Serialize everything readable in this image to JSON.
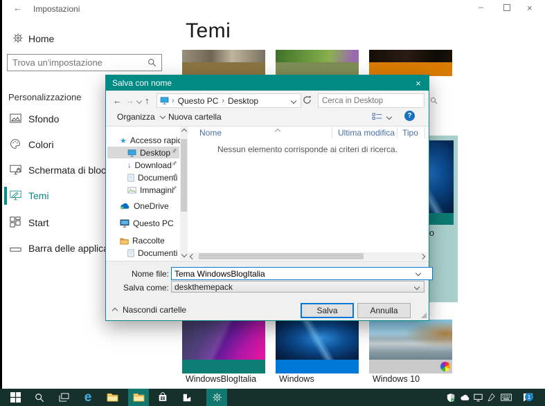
{
  "colors": {
    "accent_teal": "#008a84",
    "dialog_border": "#0b8984",
    "selection_light_teal": "#a9cfcc",
    "taskbar_bg": "#16302b",
    "taskbar_active_bg": "#11776e",
    "windows_blue": "#0078d7",
    "column_header_text": "#4a6fa5",
    "theme_bar_wbi": "#0d7e74",
    "theme_bar_windows": "#0078d7",
    "theme_bar_windows10": "#c9c9c9",
    "theme_bar_row1": [
      "#8a7441",
      "#7f8d55",
      "#d97b00"
    ]
  },
  "settings_window": {
    "titlebar": {
      "title": "Impostazioni"
    },
    "sidebar": {
      "home_label": "Home",
      "search_placeholder": "Trova un'impostazione",
      "section_label": "Personalizzazione",
      "items": [
        {
          "label": "Sfondo"
        },
        {
          "label": "Colori"
        },
        {
          "label": "Schermata di blocco"
        },
        {
          "label": "Temi",
          "selected": true
        },
        {
          "label": "Start"
        },
        {
          "label": "Barra delle applicazioni"
        }
      ]
    },
    "content": {
      "page_title": "Temi",
      "selected_theme_label_visible": "ato",
      "bottom_theme_names": [
        "WindowsBlogItalia",
        "Windows",
        "Windows 10"
      ]
    }
  },
  "save_dialog": {
    "title": "Salva con nome",
    "address": {
      "crumbs": [
        "Questo PC",
        "Desktop"
      ],
      "search_placeholder": "Cerca in Desktop"
    },
    "toolbar": {
      "organize_label": "Organizza",
      "new_folder_label": "Nuova cartella"
    },
    "nav_items": [
      {
        "label": "Accesso rapido"
      },
      {
        "label": "Desktop",
        "selected": true,
        "pinned": true
      },
      {
        "label": "Download",
        "pinned": true
      },
      {
        "label": "Documenti",
        "pinned": true
      },
      {
        "label": "Immagini",
        "pinned": true
      },
      {
        "label": "OneDrive"
      },
      {
        "label": "Questo PC"
      },
      {
        "label": "Raccolte"
      },
      {
        "label": "Documenti"
      }
    ],
    "columns": {
      "name": "Nome",
      "modified": "Ultima modifica",
      "type": "Tipo"
    },
    "empty_message": "Nessun elemento corrisponde ai criteri di ricerca.",
    "footer": {
      "filename_label": "Nome file:",
      "filename_value": "Tema WindowsBlogItalia",
      "savetype_label": "Salva come:",
      "savetype_value": "deskthemepack",
      "hide_folders_label": "Nascondi cartelle",
      "save_label": "Salva",
      "cancel_label": "Annulla"
    }
  },
  "taskbar": {
    "notification_badge": "1"
  },
  "icons": {
    "back_arrow": "←",
    "forward_arrow": "→",
    "up_arrow": "↑",
    "download_arrow": "↓",
    "close_x": "×",
    "minimize": "–",
    "crumb_separator": "›",
    "star": "★",
    "help": "?"
  }
}
